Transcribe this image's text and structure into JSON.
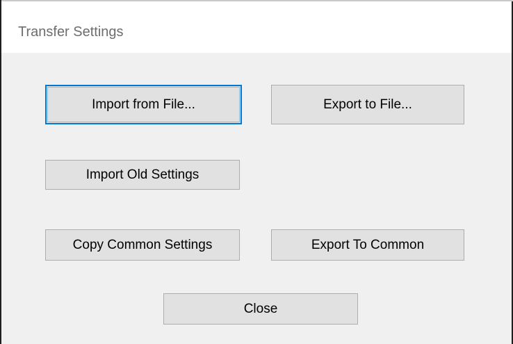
{
  "window": {
    "title": "Transfer Settings"
  },
  "buttons": {
    "import_from_file": "Import from File...",
    "export_to_file": "Export to File...",
    "import_old_settings": "Import Old Settings",
    "copy_common_settings": "Copy Common Settings",
    "export_to_common": "Export To Common",
    "close": "Close"
  },
  "colors": {
    "dialog_background": "#f0f0f0",
    "titlebar_background": "#ffffff",
    "button_face": "#e1e1e1",
    "button_border": "#adadad",
    "focus_accent": "#0078d7"
  }
}
